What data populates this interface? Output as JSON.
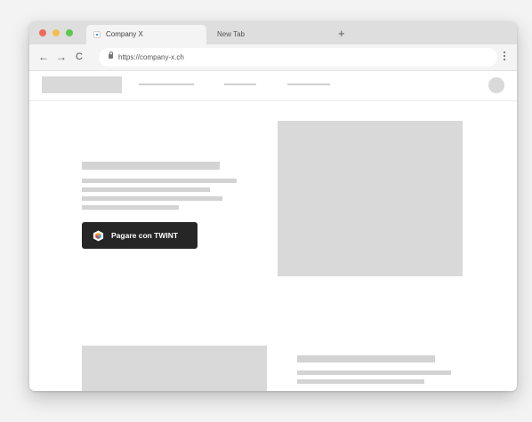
{
  "browser": {
    "tabs": [
      {
        "label": "Company X",
        "active": true
      },
      {
        "label": "New Tab",
        "active": false
      }
    ],
    "new_tab_symbol": "+",
    "nav": {
      "back": "←",
      "forward": "→",
      "reload": "C"
    },
    "url": "https://company-x.ch",
    "window_controls": {
      "close": "#ec6a5e",
      "minimize": "#f4be4f",
      "maximize": "#61c554"
    }
  },
  "page": {
    "payment_button": {
      "label": "Pagare con TWINT",
      "background": "#262626"
    }
  },
  "icons": [
    "lock-icon",
    "favicon-icon",
    "twint-logo-icon",
    "menu-kebab-icon",
    "avatar-placeholder-icon"
  ]
}
